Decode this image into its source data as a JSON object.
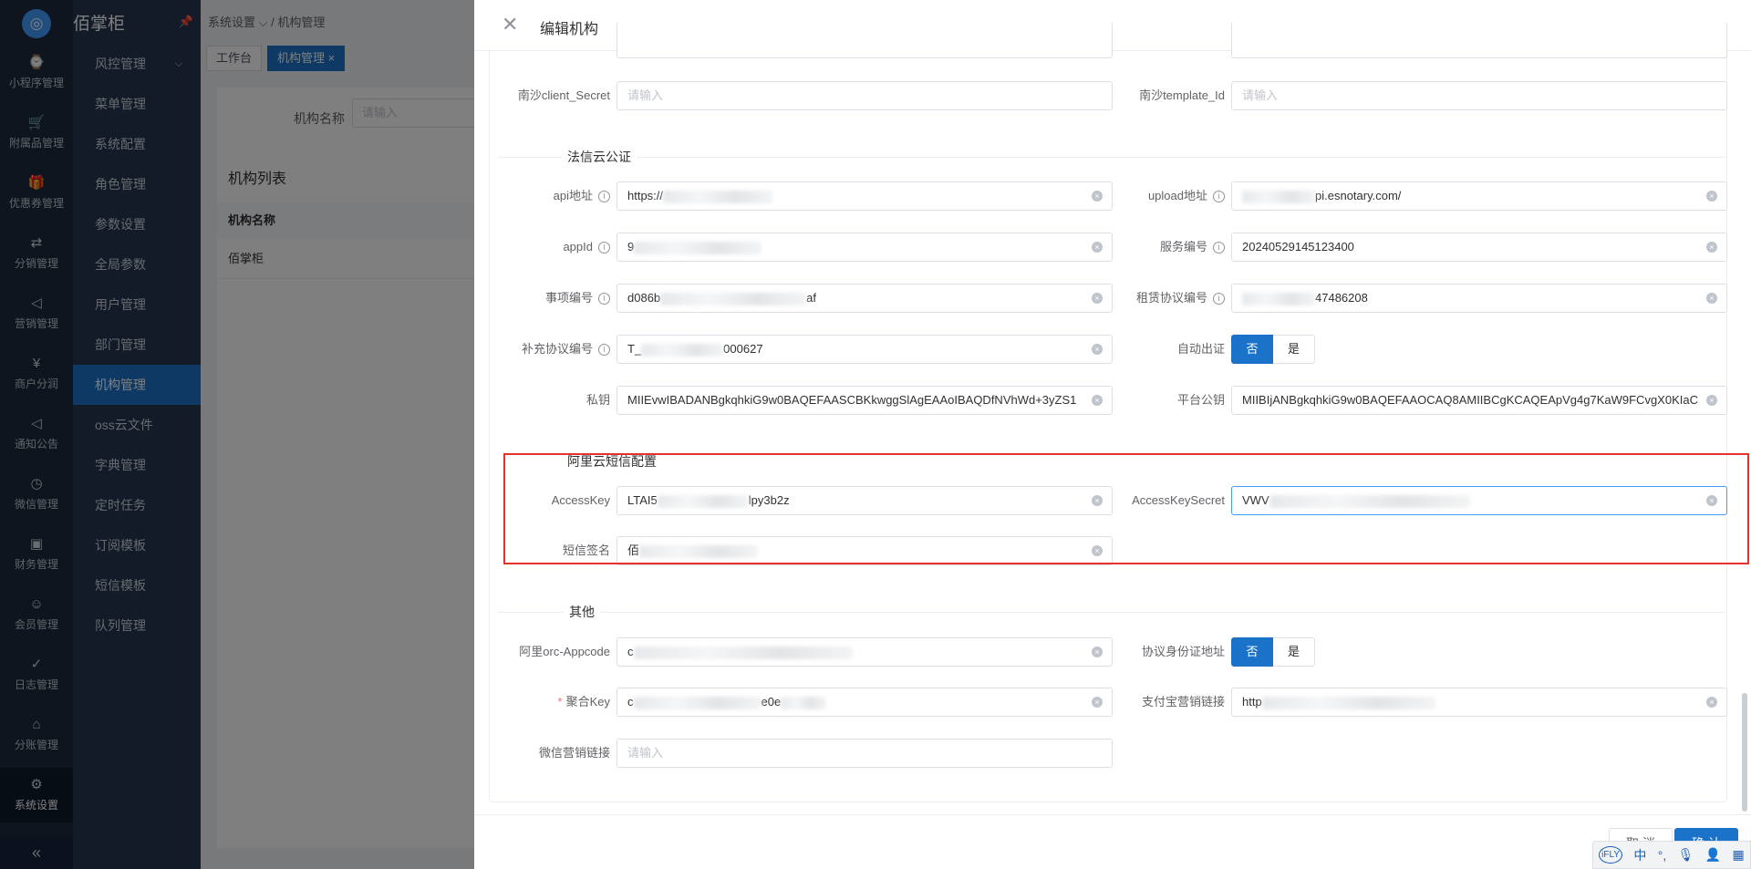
{
  "app": {
    "name": "佰掌柜"
  },
  "rail": [
    {
      "label": "小程序管理",
      "icon": "miniapp-icon"
    },
    {
      "label": "附属品管理",
      "icon": "cart-icon"
    },
    {
      "label": "优惠券管理",
      "icon": "gift-icon"
    },
    {
      "label": "分销管理",
      "icon": "share-icon"
    },
    {
      "label": "营销管理",
      "icon": "megaphone-icon"
    },
    {
      "label": "商户分润",
      "icon": "yen-icon"
    },
    {
      "label": "通知公告",
      "icon": "notice-icon"
    },
    {
      "label": "微信管理",
      "icon": "wechat-icon"
    },
    {
      "label": "财务管理",
      "icon": "finance-icon"
    },
    {
      "label": "会员管理",
      "icon": "member-icon"
    },
    {
      "label": "日志管理",
      "icon": "log-icon"
    },
    {
      "label": "分账管理",
      "icon": "split-icon"
    },
    {
      "label": "系统设置",
      "icon": "gear-icon",
      "active": true
    }
  ],
  "sidebar": [
    {
      "label": "风控管理"
    },
    {
      "label": "菜单管理"
    },
    {
      "label": "系统配置"
    },
    {
      "label": "角色管理"
    },
    {
      "label": "参数设置"
    },
    {
      "label": "全局参数"
    },
    {
      "label": "用户管理"
    },
    {
      "label": "部门管理"
    },
    {
      "label": "机构管理"
    },
    {
      "label": "oss云文件"
    },
    {
      "label": "字典管理"
    },
    {
      "label": "定时任务"
    },
    {
      "label": "订阅模板"
    },
    {
      "label": "短信模板"
    },
    {
      "label": "队列管理"
    }
  ],
  "breadcrumb": {
    "parent": "系统设置",
    "sep": "/",
    "current": "机构管理"
  },
  "tabs": [
    {
      "label": "工作台"
    },
    {
      "label": "机构管理",
      "close": "×"
    }
  ],
  "list": {
    "search_label": "机构名称",
    "search_placeholder": "请输入",
    "title": "机构列表",
    "col_name": "机构名称",
    "row_name": "佰掌柜"
  },
  "drawer": {
    "title": "编辑机构",
    "placeholder": "请输入",
    "nansha": {
      "client_secret_label": "南沙client_Secret",
      "template_id_label": "南沙template_Id"
    },
    "fxy": {
      "section": "法信云公证",
      "api_label": "api地址",
      "api_value": "https://",
      "api_value_tail": "pi.esnotary.com/",
      "upload_label": "upload地址",
      "upload_value_tail": "pi.esnotary.com/",
      "appid_label": "appId",
      "appid_value": "9",
      "service_label": "服务编号",
      "service_value": "20240529145123400",
      "item_label": "事项编号",
      "item_value": "d086b",
      "item_value_tail": "af",
      "lease_label": "租赁协议编号",
      "lease_value_tail": "47486208",
      "supp_label": "补充协议编号",
      "supp_value": "T_",
      "supp_value_tail": "000627",
      "auto_label": "自动出证",
      "private_key_label": "私钥",
      "private_key_value": "MIIEvwIBADANBgkqhkiG9w0BAQEFAASCBKkwggSlAgEAAoIBAQDfNVhWd+3yZS1",
      "platform_key_label": "平台公钥",
      "platform_key_value": "MIIBIjANBgkqhkiG9w0BAQEFAAOCAQ8AMIIBCgKCAQEApVg4g7KaW9FCvgX0KIaC"
    },
    "aliyun": {
      "section": "阿里云短信配置",
      "ak_label": "AccessKey",
      "ak_value": "LTAI5",
      "ak_value_tail": "lpy3b2z",
      "aks_label": "AccessKeySecret",
      "aks_value": "VWV",
      "sign_label": "短信签名",
      "sign_value": "佰"
    },
    "other": {
      "section": "其他",
      "orc_label": "阿里orc-Appcode",
      "orc_value": "c",
      "idaddr_label": "协议身份证地址",
      "juhe_label": "聚合Key",
      "juhe_value": "c",
      "juhe_value_tail": "e0e",
      "alipay_label": "支付宝营销链接",
      "alipay_value": "http",
      "wechat_label": "微信营销链接"
    },
    "toggle": {
      "no": "否",
      "yes": "是"
    },
    "footer": {
      "cancel": "取 消",
      "ok": "确 认"
    }
  },
  "ime": {
    "brand": "iFLY",
    "lang": "中"
  },
  "colors": {
    "primary": "#1a72c9",
    "rail": "#1c2b3f",
    "sidebar": "#25374f",
    "highlight_box": "#e5322d"
  }
}
